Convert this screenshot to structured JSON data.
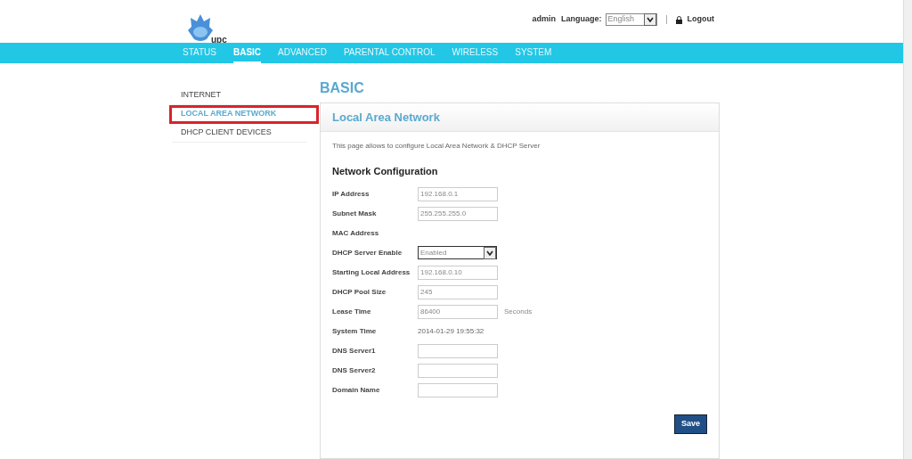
{
  "header": {
    "logo_text": "upc",
    "user": "admin",
    "language_label": "Language:",
    "language_value": "English",
    "logout": "Logout"
  },
  "nav": [
    {
      "label": "STATUS",
      "selected": false
    },
    {
      "label": "BASIC",
      "selected": true
    },
    {
      "label": "ADVANCED",
      "selected": false
    },
    {
      "label": "PARENTAL CONTROL",
      "selected": false
    },
    {
      "label": "WIRELESS",
      "selected": false
    },
    {
      "label": "SYSTEM",
      "selected": false
    }
  ],
  "sidebar": [
    {
      "label": "INTERNET",
      "selected": false,
      "outlined": false
    },
    {
      "label": "LOCAL AREA NETWORK",
      "selected": true,
      "outlined": true
    },
    {
      "label": "DHCP CLIENT DEVICES",
      "selected": false,
      "outlined": false
    }
  ],
  "page_title": "BASIC",
  "panel": {
    "title": "Local Area Network",
    "description": "This page allows to configure Local Area Network & DHCP Server",
    "section": "Network Configuration",
    "fields": [
      {
        "kind": "input",
        "label": "IP Address",
        "value": "192.168.0.1"
      },
      {
        "kind": "input",
        "label": "Subnet Mask",
        "value": "255.255.255.0"
      },
      {
        "kind": "static",
        "label": "MAC Address"
      },
      {
        "kind": "select",
        "label": "DHCP Server Enable",
        "value": "Enabled"
      },
      {
        "kind": "input",
        "label": "Starting Local Address",
        "value": "192.168.0.10"
      },
      {
        "kind": "input",
        "label": "DHCP Pool Size",
        "value": "245"
      },
      {
        "kind": "input",
        "label": "Lease Time",
        "value": "86400",
        "suffix": "Seconds"
      },
      {
        "kind": "static",
        "label": "System Time",
        "value": "2014-01-29 19:55:32"
      },
      {
        "kind": "input",
        "label": "DNS Server1"
      },
      {
        "kind": "input",
        "label": "DNS Server2"
      },
      {
        "kind": "input",
        "label": "Domain Name"
      }
    ],
    "save": "Save"
  }
}
